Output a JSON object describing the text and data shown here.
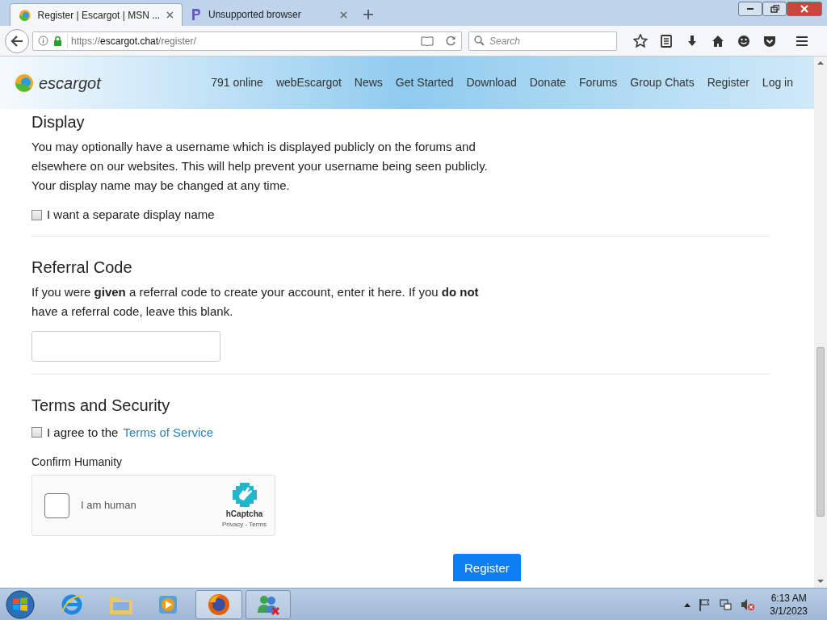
{
  "browser_tabs": [
    {
      "title": "Register | Escargot | MSN ...",
      "selected": true,
      "kind": "escargot"
    },
    {
      "title": "Unsupported browser",
      "selected": false,
      "kind": "p"
    }
  ],
  "address_bar": {
    "scheme": "https://",
    "domain": "escargot.chat",
    "path": "/register/"
  },
  "search": {
    "placeholder": "Search"
  },
  "site": {
    "logo": "escargot",
    "nav": [
      "791 online",
      "webEscargot",
      "News",
      "Get Started",
      "Download",
      "Donate",
      "Forums",
      "Group Chats",
      "Register",
      "Log in"
    ]
  },
  "display": {
    "heading": "Display",
    "text": "You may optionally have a username which is displayed publicly on the forums and elsewhere on our websites. This will help prevent your username being seen publicly. Your display name may be changed at any time.",
    "checkbox": {
      "label": "I want a separate display name",
      "checked": false
    }
  },
  "referral": {
    "heading": "Referral Code",
    "text": "If you were **given** a referral code to create your account, enter it here. If you **do not** have a referral code, leave this blank."
  },
  "terms": {
    "heading": "Terms and Security",
    "checkbox": {
      "label": "I agree to the",
      "link": "Terms of Service",
      "checked": false
    },
    "captcha_label": "Confirm Humanity",
    "captcha": {
      "label": "I am human",
      "brand": "hCaptcha",
      "links": "Privacy - Terms",
      "checked": false
    }
  },
  "register_button": "Register",
  "taskbar": {
    "time": "6:13 AM",
    "date": "3/1/2023"
  }
}
